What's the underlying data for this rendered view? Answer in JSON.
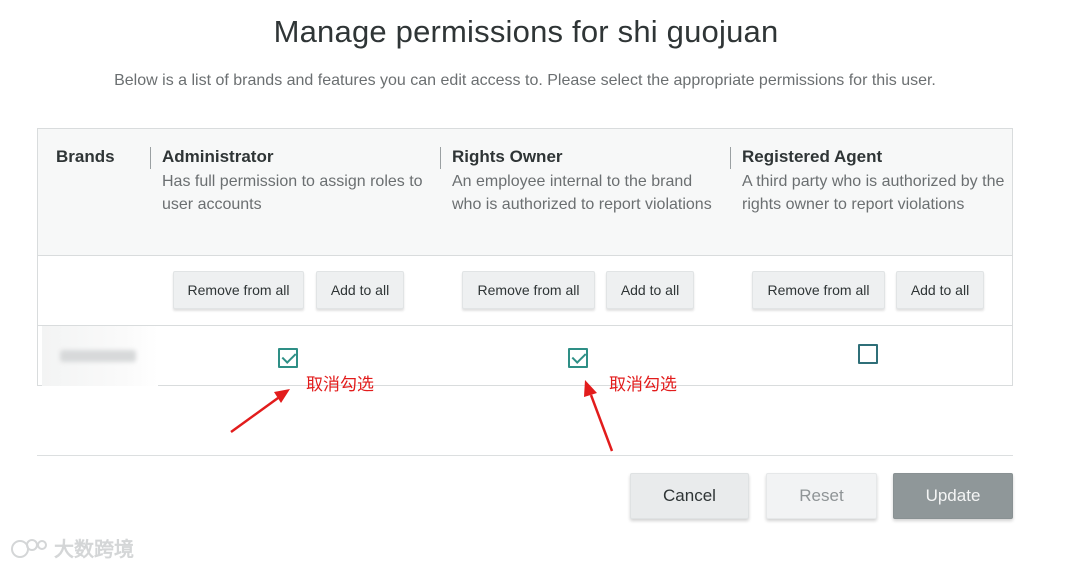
{
  "header": {
    "title": "Manage permissions for shi guojuan",
    "subtitle": "Below is a list of brands and features you can edit access to. Please select the appropriate permissions for this user."
  },
  "table": {
    "brands_header": "Brands",
    "roles": [
      {
        "name": "Administrator",
        "description": "Has full permission to assign roles to user accounts",
        "remove_label": "Remove from all",
        "add_label": "Add to all"
      },
      {
        "name": "Rights Owner",
        "description": "An employee internal to the brand who is authorized to report violations",
        "remove_label": "Remove from all",
        "add_label": "Add to all"
      },
      {
        "name": "Registered Agent",
        "description": "A third party who is authorized by the rights owner to report violations",
        "remove_label": "Remove from all",
        "add_label": "Add to all"
      }
    ],
    "brand_row": {
      "checks": [
        true,
        true,
        false
      ]
    }
  },
  "annotations": {
    "uncheck_label": "取消勾选",
    "color": "#e21c1c"
  },
  "footer": {
    "cancel_label": "Cancel",
    "reset_label": "Reset",
    "update_label": "Update"
  },
  "watermark": {
    "text": "大数跨境"
  },
  "colors": {
    "accent": "#2e8f86",
    "update_bg": "#8f9799"
  }
}
